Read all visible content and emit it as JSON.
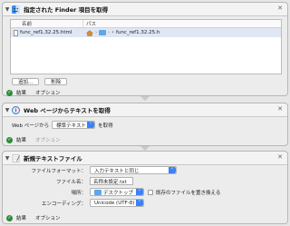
{
  "card1": {
    "title": "指定された Finder 項目を取得",
    "col_name": "名前",
    "col_path": "パス",
    "rows": [
      {
        "name": "func_ref1.32.25.html",
        "path_end": "func_ref1.32.25.h"
      }
    ],
    "add_label": "追加...",
    "remove_label": "削除",
    "footer_results": "結果",
    "footer_options": "オプション"
  },
  "card2": {
    "title": "Web ページからテキストを取得",
    "prefix": "Web ページから",
    "format_value": "標準テキスト",
    "suffix": "を取得",
    "footer_results": "結果",
    "footer_options": "オプション"
  },
  "card3": {
    "title": "新規テキストファイル",
    "format_label": "ファイルフォーマット：",
    "format_value": "入力テキストと同じ",
    "filename_label": "ファイル名：",
    "filename_value": "名称未設定.txt",
    "location_label": "場所：",
    "location_value": "デスクトップ",
    "replace_label": "既存のファイルを置き換える",
    "encoding_label": "エンコーディング：",
    "encoding_value": "Unicode (UTF-8)",
    "footer_results": "結果",
    "footer_options": "オプション"
  },
  "colors": {
    "accent": "#3b82f6",
    "ok": "#2e8b3a"
  },
  "icons": [
    "finder-icon",
    "safari-icon",
    "textedit-icon",
    "home-icon",
    "folder-icon",
    "desktop-folder-icon",
    "checkmark-icon",
    "close-icon"
  ]
}
